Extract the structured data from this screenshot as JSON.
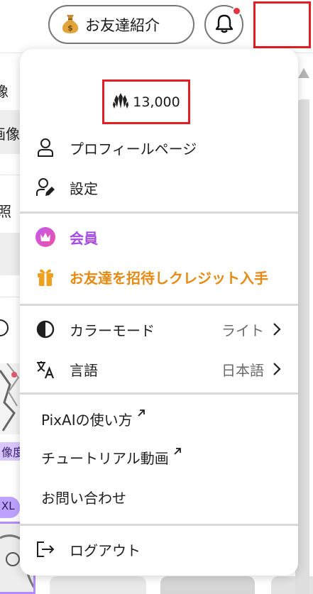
{
  "header": {
    "referral_label": "お友達紹介",
    "referral_icon": "money-bag-icon",
    "notification_icon": "bell-icon",
    "notification_dot_color": "#e5343f"
  },
  "menu": {
    "credits": "13,000",
    "credit_icon": "credit-crystal-icon",
    "profile_label": "プロフィールページ",
    "settings_label": "設定",
    "membership_label": "会員",
    "invite_label": "お友達を招待しクレジット入手",
    "color_mode_label": "カラーモード",
    "color_mode_value": "ライト",
    "language_label": "言語",
    "language_value": "日本語",
    "howto_label": "PixAIの使い方",
    "tutorial_label": "チュートリアル動画",
    "contact_label": "お問い合わせ",
    "logout_label": "ログアウト"
  },
  "background": {
    "fragments": [
      "像",
      "画像",
      "照",
      "像度",
      "XL"
    ]
  },
  "colors": {
    "accent_purple": "#a64bde",
    "accent_orange": "#e58a12",
    "highlight_red": "#e11d25"
  }
}
